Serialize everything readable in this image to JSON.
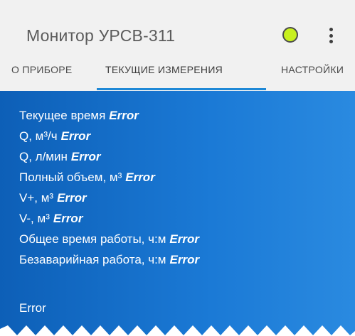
{
  "app": {
    "title": "Монитор УРСВ-311",
    "status_color": "#c8f01f",
    "menu_icon": "more-vertical-icon"
  },
  "tabs": [
    {
      "label": "О ПРИБОРЕ",
      "selected": false
    },
    {
      "label": "ТЕКУЩИЕ ИЗМЕРЕНИЯ",
      "selected": true
    },
    {
      "label": "НАСТРОЙКИ",
      "selected": false
    }
  ],
  "measurements": [
    {
      "label": "Текущее время",
      "value": "Error"
    },
    {
      "label": "Q, м³/ч",
      "value": "Error"
    },
    {
      "label": "Q, л/мин",
      "value": "Error"
    },
    {
      "label": "Полный объем, м³",
      "value": "Error"
    },
    {
      "label": "V+, м³",
      "value": "Error"
    },
    {
      "label": "V-, м³",
      "value": "Error"
    },
    {
      "label": "Общее время работы, ч:м",
      "value": "Error"
    },
    {
      "label": "Безаварийная работа, ч:м",
      "value": "Error"
    }
  ],
  "status_text": "Error",
  "colors": {
    "panel": "#0d5fb7",
    "tab_indicator": "#1e88d6",
    "appbar": "#f1f1f1"
  }
}
